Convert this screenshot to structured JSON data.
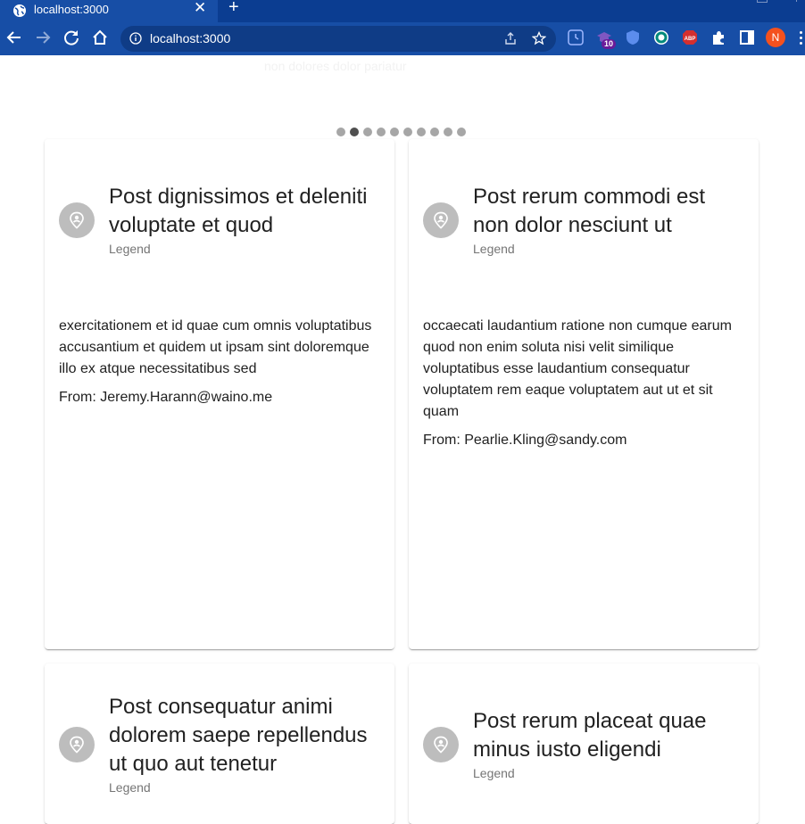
{
  "browser": {
    "tab_title": "localhost:3000",
    "tab_close": "✕",
    "new_tab": "+",
    "url": "localhost:3000",
    "extension_badge": "10",
    "profile_initial": "N",
    "extensions": [
      "history-clock-icon",
      "graduation-cap-icon",
      "shield-extension-icon",
      "ring-extension-icon",
      "adblock-plus-icon",
      "puzzle-piece-icon",
      "side-panel-icon"
    ]
  },
  "page": {
    "faint_heading": "non dolores dolor pariatur",
    "carousel": {
      "dot_count": 10,
      "active_index": 1
    }
  },
  "posts": [
    {
      "title": "Post dignissimos et deleniti voluptate et quod",
      "subheader": "Legend",
      "body": "exercitationem et id quae cum omnis voluptatibus accusantium et quidem ut ipsam sint doloremque illo ex atque necessitatibus sed",
      "from": "From: Jeremy.Harann@waino.me"
    },
    {
      "title": "Post rerum commodi est non dolor nesciunt ut",
      "subheader": "Legend",
      "body": "occaecati laudantium ratione non cumque earum quod non enim soluta nisi velit similique voluptatibus esse laudantium consequatur voluptatem rem eaque voluptatem aut ut et sit quam",
      "from": "From: Pearlie.Kling@sandy.com"
    },
    {
      "title": "Post consequatur animi dolorem saepe repellendus ut quo aut tenetur",
      "subheader": "Legend"
    },
    {
      "title": "Post rerum placeat quae minus iusto eligendi",
      "subheader": "Legend"
    }
  ],
  "colors": {
    "chrome_dark": "#0b3d91",
    "chrome_toolbar": "#174ea6",
    "avatar_bg": "#bdbdbd",
    "dot_active": "#4f4f4f",
    "dot_inactive": "#a6a6a6",
    "profile": "#f4511e"
  }
}
